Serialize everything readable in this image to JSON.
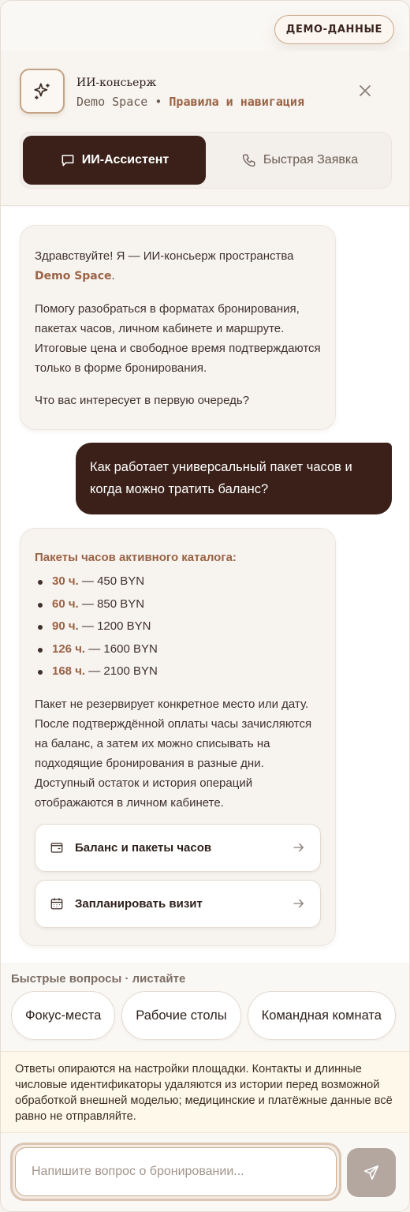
{
  "badge": {
    "label": "ДЕМО-ДАННЫЕ"
  },
  "header": {
    "title": "ИИ-консьерж",
    "brand": "Demo Space",
    "separator": "•",
    "section": "Правила и навигация",
    "logo_icon": "sparkles-icon",
    "close_icon": "close-icon"
  },
  "tabs": [
    {
      "label": "ИИ-Ассистент",
      "icon": "chat-bubble-icon",
      "active": true
    },
    {
      "label": "Быстрая Заявка",
      "icon": "phone-icon",
      "active": false
    }
  ],
  "messages": {
    "greeting": {
      "p1_prefix": "Здравствуйте! Я — ИИ-консьерж пространства",
      "p1_brand": "Demo Space",
      "p1_suffix": ".",
      "p2": "Помогу разобраться в форматах бронирования, пакетах часов, личном кабинете и маршруте. Итоговые цена и свободное время подтверждаются только в форме бронирования.",
      "p3": "Что вас интересует в первую очередь?"
    },
    "user": {
      "text": "Как работает универсальный пакет часов и когда можно тратить баланс?"
    },
    "answer": {
      "heading": "Пакеты часов активного каталога:",
      "packages": [
        {
          "hours": "30 ч.",
          "price": "— 450 BYN"
        },
        {
          "hours": "60 ч.",
          "price": "— 850 BYN"
        },
        {
          "hours": "90 ч.",
          "price": "— 1200 BYN"
        },
        {
          "hours": "126 ч.",
          "price": "— 1600 BYN"
        },
        {
          "hours": "168 ч.",
          "price": "— 2100 BYN"
        }
      ],
      "body": "Пакет не резервирует конкретное место или дату. После подтверждённой оплаты часы зачисляются на баланс, а затем их можно списывать на подходящие бронирования в разные дни. Доступный остаток и история операций отображаются в личном кабинете.",
      "links": [
        {
          "label": "Баланс и пакеты часов",
          "icon": "wallet-icon"
        },
        {
          "label": "Запланировать визит",
          "icon": "calendar-icon"
        }
      ]
    }
  },
  "quick": {
    "label": "Быстрые вопросы · листайте",
    "chips": [
      "Фокус-места",
      "Рабочие столы",
      "Командная комната"
    ]
  },
  "notice": {
    "text": "Ответы опираются на настройки площадки. Контакты и длинные числовые идентификаторы удаляются из истории перед возможной обработкой внешней моделью; медицинские и платёжные данные всё равно не отправляйте."
  },
  "composer": {
    "placeholder": "Напишите вопрос о бронировании...",
    "send_icon": "send-icon"
  },
  "colors": {
    "accent": "#9a6244",
    "dark": "#3a2018",
    "notice_bg": "#fdf8ea"
  }
}
